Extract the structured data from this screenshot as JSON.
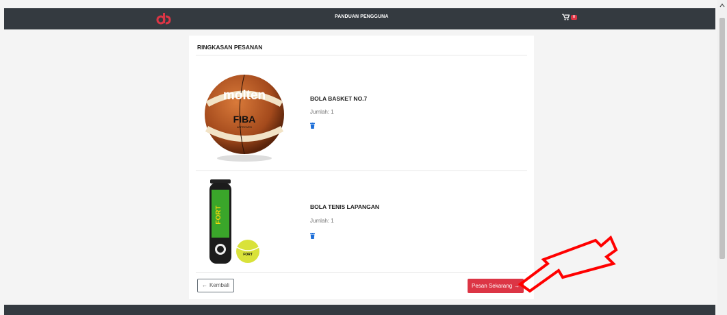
{
  "navbar": {
    "logo": "logo-icon",
    "nav_link": "PANDUAN PENGGUNA",
    "cart_icon": "cart-icon",
    "cart_count": "0"
  },
  "summary": {
    "title": "RINGKASAN PESANAN",
    "items": [
      {
        "name": "BOLA BASKET NO.7",
        "qty_label": "Jumlah: 1",
        "image": "basketball-image",
        "delete_icon": "trash-icon"
      },
      {
        "name": "BOLA TENIS LAPANGAN",
        "qty_label": "Jumlah: 1",
        "image": "tennis-ball-can-image",
        "delete_icon": "trash-icon"
      }
    ],
    "back_button": "Kembali",
    "order_button": "Pesan Sekarang"
  },
  "colors": {
    "navbar": "#343a40",
    "primary_red": "#dc3545",
    "trash_blue": "#1e6fd9",
    "annotation_red": "#ff0000"
  }
}
